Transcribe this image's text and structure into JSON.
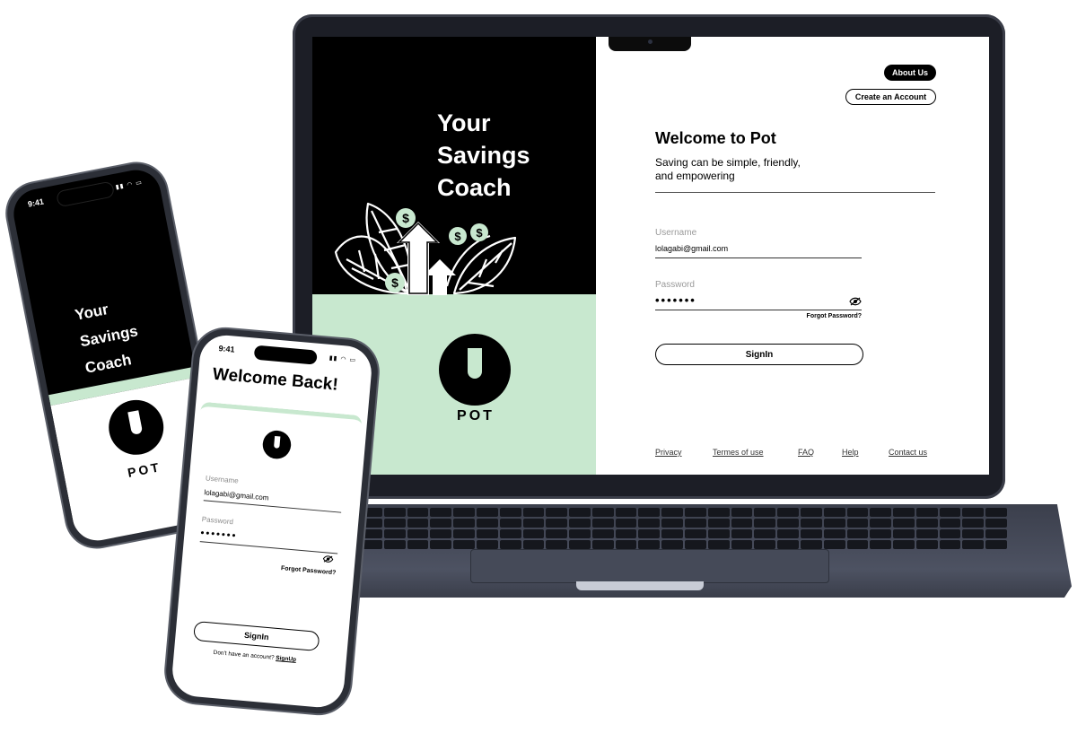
{
  "laptop": {
    "headline": "Your\nSavings\nCoach",
    "brand": "POT",
    "nav": {
      "about": "About Us",
      "create_account": "Create an Account"
    },
    "welcome_title": "Welcome to Pot",
    "welcome_subtitle": "Saving can be simple, friendly,\nand empowering",
    "username_label": "Username",
    "username_value": "lolagabi@gmail.com",
    "password_label": "Password",
    "password_value": "•••••••",
    "forgot": "Forgot Password?",
    "signin": "SignIn",
    "footer": [
      "Privacy",
      "Termes of use",
      "FAQ",
      "Help",
      "Contact us"
    ]
  },
  "phone_splash": {
    "time": "9:41",
    "headline": "Your\nSavings\nCoach",
    "brand": "POT"
  },
  "phone_login": {
    "time": "9:41",
    "title": "Welcome Back!",
    "username_label": "Username",
    "username_value": "lolagabi@gmail.com",
    "password_label": "Password",
    "password_value": "•••••••",
    "forgot": "Forgot Password?",
    "signin": "SignIn",
    "no_account": "Don't have an account?",
    "signup": "SignUp"
  },
  "icons": [
    "eye-off-icon",
    "pot-logo-icon",
    "plant-dollar-illustration",
    "signal-icon",
    "wifi-icon",
    "battery-icon"
  ],
  "colors": {
    "mint": "#c8e8cf",
    "black": "#000000",
    "device": "#2c2f37"
  }
}
